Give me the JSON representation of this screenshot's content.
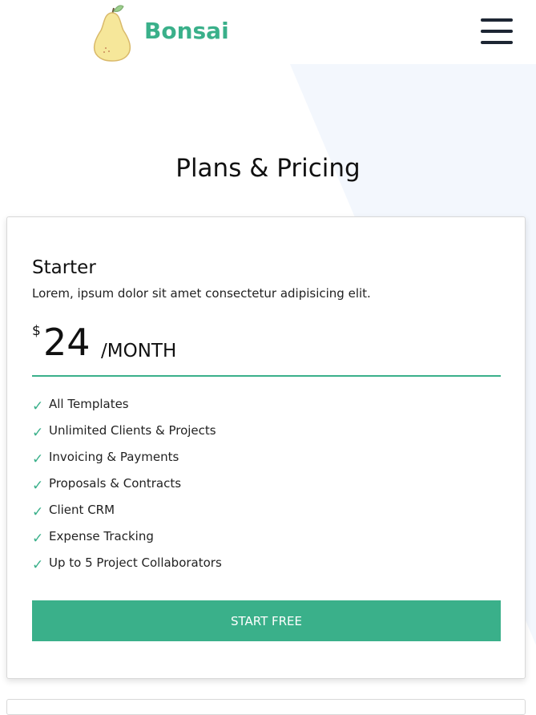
{
  "header": {
    "brand": "Bonsai",
    "logo_icon": "pear-logo-icon",
    "menu_icon": "hamburger-menu-icon"
  },
  "page": {
    "title": "Plans & Pricing"
  },
  "plan": {
    "name": "Starter",
    "description": "Lorem, ipsum dolor sit amet consectetur adipisicing elit.",
    "currency": "$",
    "amount": "24",
    "period": "/MONTH",
    "features": [
      "All Templates",
      "Unlimited Clients & Projects",
      "Invoicing & Payments",
      "Proposals & Contracts",
      "Client CRM",
      "Expense Tracking",
      "Up to 5 Project Collaborators"
    ],
    "check_mark": "✓",
    "cta_label": "START FREE"
  },
  "colors": {
    "accent": "#3ab08a",
    "menu": "#1d2633",
    "background_shape": "#f3f7fd"
  }
}
